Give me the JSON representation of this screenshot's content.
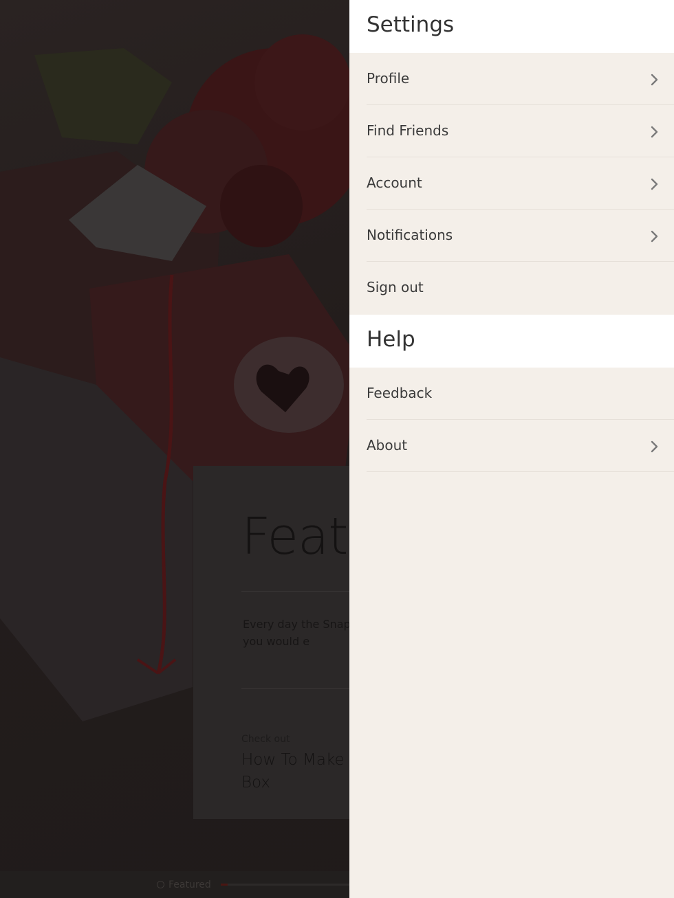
{
  "background": {
    "featured_heading": "Featu",
    "featured_body": "Every day the Snapg creative how-to guide thought you would e",
    "check_out_label": "Check out",
    "guide_title": "How To Make A Valentine Box",
    "bottom_tab_label": "Featured"
  },
  "settings": {
    "title": "Settings",
    "items": [
      {
        "label": "Profile",
        "icon": "chevron-right-icon"
      },
      {
        "label": "Find Friends",
        "icon": "chevron-right-icon"
      },
      {
        "label": "Account",
        "icon": "chevron-right-icon"
      },
      {
        "label": "Notifications",
        "icon": "chevron-right-icon"
      },
      {
        "label": "Sign out"
      }
    ]
  },
  "help": {
    "title": "Help",
    "items": [
      {
        "label": "Feedback"
      },
      {
        "label": "About",
        "icon": "chevron-right-icon"
      }
    ]
  },
  "colors": {
    "drawer_bg": "#f4efe9",
    "header_bg": "#ffffff",
    "overlay": "#1e1a19"
  }
}
